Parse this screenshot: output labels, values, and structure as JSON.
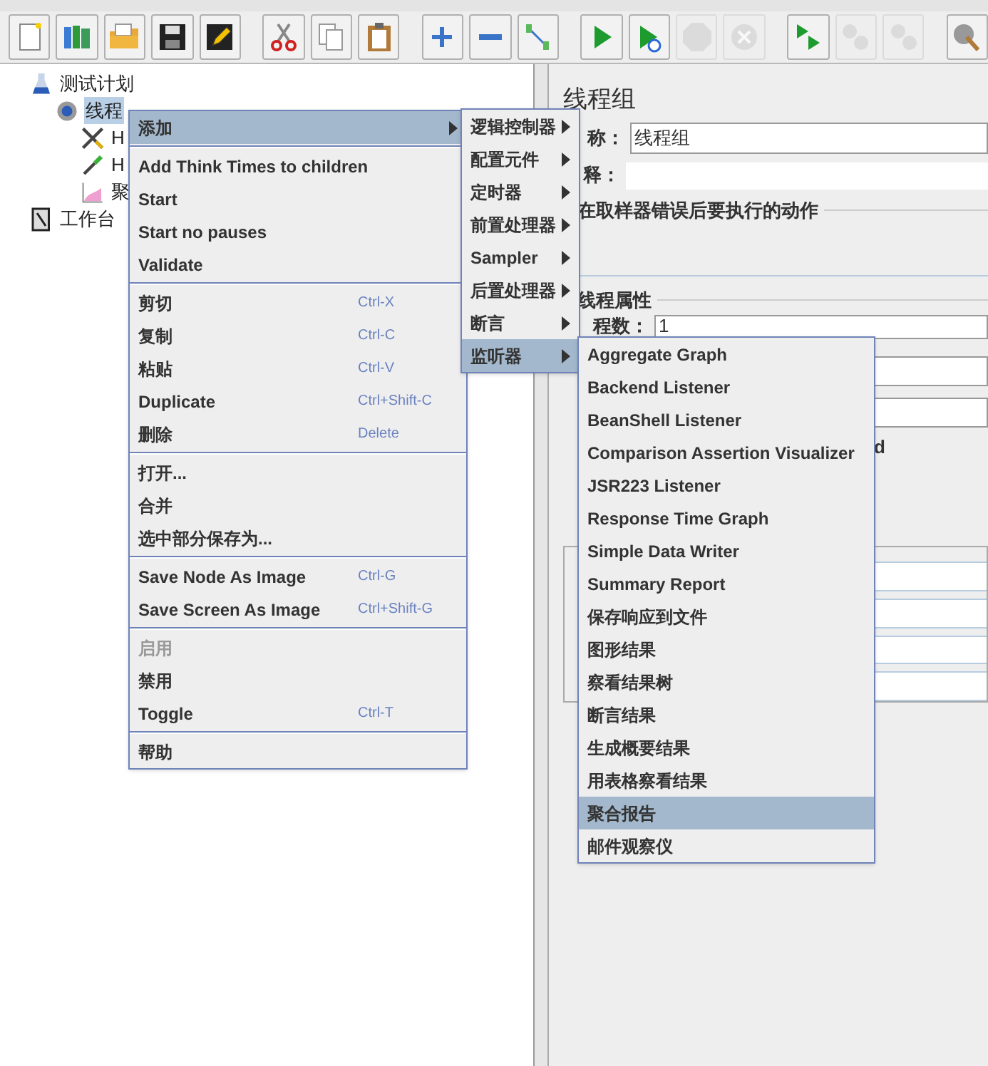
{
  "toolbar": {
    "buttons": [
      {
        "kind": "new",
        "disabled": false
      },
      {
        "kind": "templates",
        "disabled": false
      },
      {
        "kind": "open",
        "disabled": false
      },
      {
        "kind": "save",
        "disabled": false
      },
      {
        "kind": "edit",
        "disabled": false
      },
      {
        "kind": "cut",
        "disabled": false
      },
      {
        "kind": "copy",
        "disabled": false
      },
      {
        "kind": "paste",
        "disabled": false
      },
      {
        "kind": "expand",
        "disabled": false
      },
      {
        "kind": "collapse",
        "disabled": false
      },
      {
        "kind": "toggle",
        "disabled": false
      },
      {
        "kind": "start",
        "disabled": false
      },
      {
        "kind": "start-no-pause",
        "disabled": false
      },
      {
        "kind": "stop",
        "disabled": true
      },
      {
        "kind": "shutdown",
        "disabled": true
      },
      {
        "kind": "remote-start",
        "disabled": false
      },
      {
        "kind": "remote-stop",
        "disabled": true
      },
      {
        "kind": "remote-shutdown",
        "disabled": true
      },
      {
        "kind": "clear",
        "disabled": false
      }
    ]
  },
  "tree": [
    {
      "label": "测试计划",
      "kind": "plan",
      "selected": false,
      "children": [
        {
          "label": "线程",
          "kind": "threads",
          "selected": true,
          "children": [
            {
              "label": "H",
              "kind": "sampler",
              "selected": false
            },
            {
              "label": "H",
              "kind": "config",
              "selected": false
            },
            {
              "label": "聚",
              "kind": "listener",
              "selected": false
            }
          ]
        }
      ]
    },
    {
      "label": "工作台",
      "kind": "workbench",
      "selected": false
    }
  ],
  "panel": {
    "title": "线程组",
    "name_label": "称：",
    "name_value": "线程组",
    "comment_label": "释：",
    "error_section": "在取样器错误后要执行的动作",
    "props_section": "线程属性",
    "threads_label": "程数：",
    "threads_value": "1",
    "fragment": "d"
  },
  "context_menu": {
    "groups": [
      [
        {
          "label": "添加",
          "submenu": true,
          "selected": true,
          "disabled": false
        }
      ],
      [
        {
          "label": "Add Think Times to children",
          "submenu": false,
          "selected": false,
          "disabled": false
        },
        {
          "label": "Start",
          "submenu": false,
          "selected": false,
          "disabled": false
        },
        {
          "label": "Start no pauses",
          "submenu": false,
          "selected": false,
          "disabled": false
        },
        {
          "label": "Validate",
          "submenu": false,
          "selected": false,
          "disabled": false
        }
      ],
      [
        {
          "label": "剪切",
          "shortcut": "Ctrl-X",
          "submenu": false,
          "selected": false,
          "disabled": false
        },
        {
          "label": "复制",
          "shortcut": "Ctrl-C",
          "submenu": false,
          "selected": false,
          "disabled": false
        },
        {
          "label": "粘贴",
          "shortcut": "Ctrl-V",
          "submenu": false,
          "selected": false,
          "disabled": false
        },
        {
          "label": "Duplicate",
          "shortcut": "Ctrl+Shift-C",
          "submenu": false,
          "selected": false,
          "disabled": false
        },
        {
          "label": "删除",
          "shortcut": "Delete",
          "submenu": false,
          "selected": false,
          "disabled": false
        }
      ],
      [
        {
          "label": "打开...",
          "submenu": false,
          "selected": false,
          "disabled": false
        },
        {
          "label": "合并",
          "submenu": false,
          "selected": false,
          "disabled": false
        },
        {
          "label": "选中部分保存为...",
          "submenu": false,
          "selected": false,
          "disabled": false
        }
      ],
      [
        {
          "label": "Save Node As Image",
          "shortcut": "Ctrl-G",
          "submenu": false,
          "selected": false,
          "disabled": false
        },
        {
          "label": "Save Screen As Image",
          "shortcut": "Ctrl+Shift-G",
          "submenu": false,
          "selected": false,
          "disabled": false
        }
      ],
      [
        {
          "label": "启用",
          "submenu": false,
          "selected": false,
          "disabled": true
        },
        {
          "label": "禁用",
          "submenu": false,
          "selected": false,
          "disabled": false
        },
        {
          "label": "Toggle",
          "shortcut": "Ctrl-T",
          "submenu": false,
          "selected": false,
          "disabled": false
        }
      ],
      [
        {
          "label": "帮助",
          "submenu": false,
          "selected": false,
          "disabled": false
        }
      ]
    ]
  },
  "add_submenu": [
    {
      "label": "逻辑控制器",
      "submenu": true,
      "selected": false
    },
    {
      "label": "配置元件",
      "submenu": true,
      "selected": false
    },
    {
      "label": "定时器",
      "submenu": true,
      "selected": false
    },
    {
      "label": "前置处理器",
      "submenu": true,
      "selected": false
    },
    {
      "label": "Sampler",
      "submenu": true,
      "selected": false
    },
    {
      "label": "后置处理器",
      "submenu": true,
      "selected": false
    },
    {
      "label": "断言",
      "submenu": true,
      "selected": false
    },
    {
      "label": "监听器",
      "submenu": true,
      "selected": true
    }
  ],
  "listener_submenu": [
    {
      "label": "Aggregate Graph",
      "selected": false
    },
    {
      "label": "Backend Listener",
      "selected": false
    },
    {
      "label": "BeanShell Listener",
      "selected": false
    },
    {
      "label": "Comparison Assertion Visualizer",
      "selected": false
    },
    {
      "label": "JSR223 Listener",
      "selected": false
    },
    {
      "label": "Response Time Graph",
      "selected": false
    },
    {
      "label": "Simple Data Writer",
      "selected": false
    },
    {
      "label": "Summary Report",
      "selected": false
    },
    {
      "label": "保存响应到文件",
      "selected": false
    },
    {
      "label": "图形结果",
      "selected": false
    },
    {
      "label": "察看结果树",
      "selected": false
    },
    {
      "label": "断言结果",
      "selected": false
    },
    {
      "label": "生成概要结果",
      "selected": false
    },
    {
      "label": "用表格察看结果",
      "selected": false
    },
    {
      "label": "聚合报告",
      "selected": true
    },
    {
      "label": "邮件观察仪",
      "selected": false
    }
  ]
}
